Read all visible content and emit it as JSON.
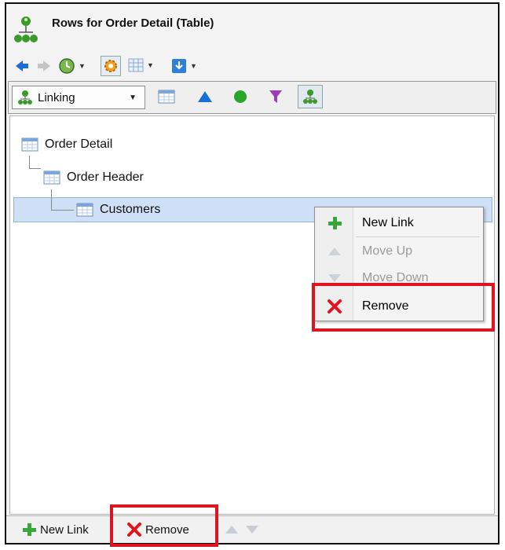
{
  "window": {
    "title": "Rows for Order Detail (Table)"
  },
  "toolbar": {
    "icons": [
      "back-icon",
      "forward-icon",
      "clock-icon",
      "settings-icon",
      "grid-icon",
      "export-icon"
    ]
  },
  "view_selector": {
    "selected": "Linking"
  },
  "tree": {
    "items": [
      {
        "label": "Order Detail"
      },
      {
        "label": "Order Header"
      },
      {
        "label": "Customers"
      }
    ]
  },
  "context_menu": {
    "new_link": "New Link",
    "move_up": "Move Up",
    "move_down": "Move Down",
    "remove": "Remove"
  },
  "bottom_bar": {
    "new_link": "New Link",
    "remove": "Remove"
  },
  "colors": {
    "highlight": "#e0141e",
    "selection": "#cfe0f6",
    "accent_blue": "#1a6fd6",
    "green": "#2aa52a"
  }
}
